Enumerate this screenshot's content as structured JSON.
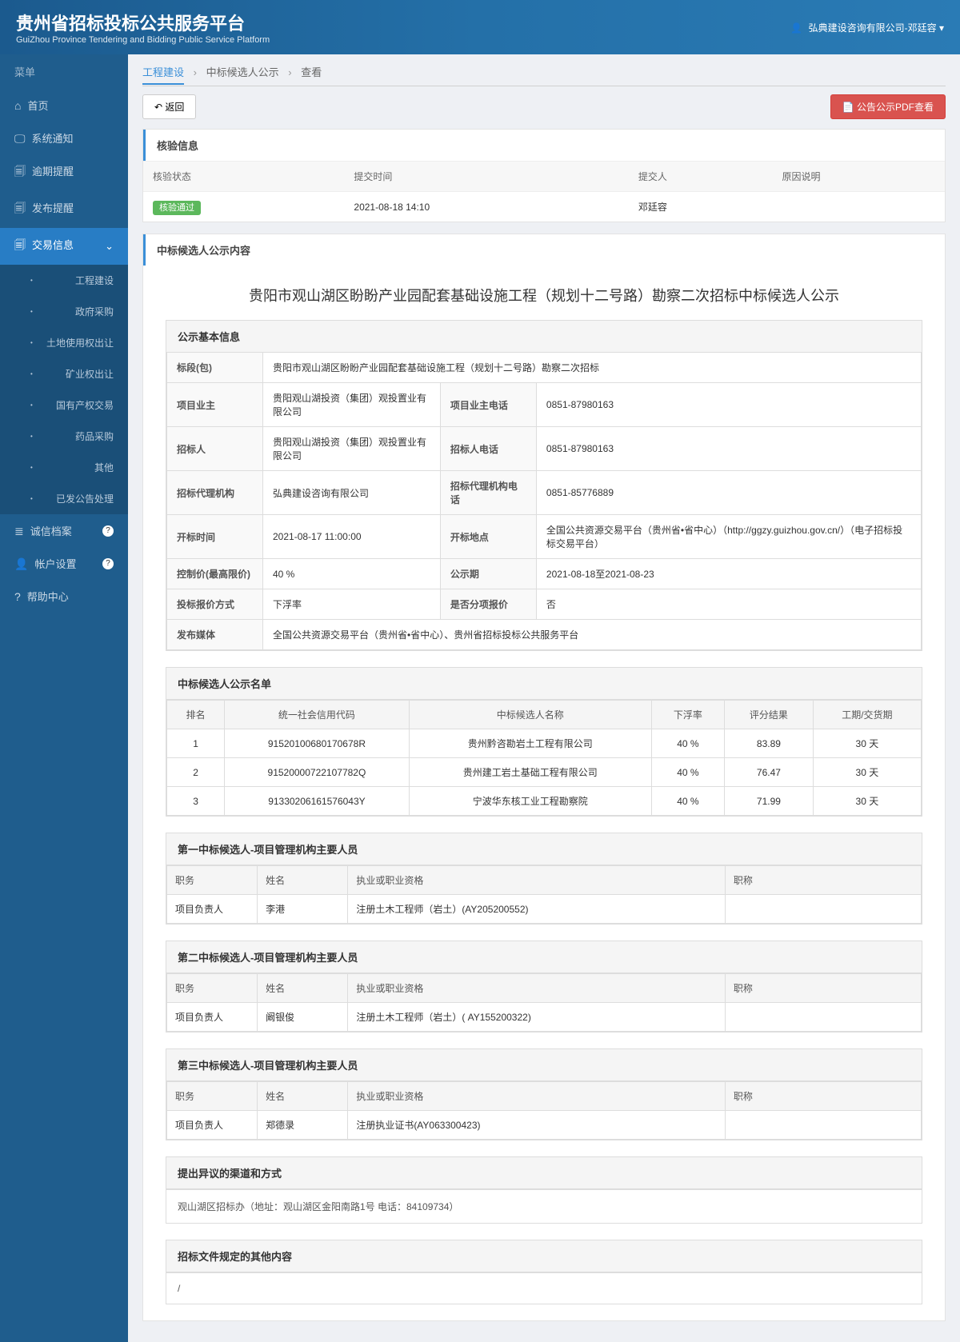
{
  "header": {
    "title": "贵州省招标投标公共服务平台",
    "subtitle": "GuiZhou Province Tendering and Bidding Public Service Platform",
    "user": "弘典建设咨询有限公司-邓廷容"
  },
  "sidebar": {
    "menu_label": "菜单",
    "items": [
      {
        "label": "首页",
        "icon": "⌂"
      },
      {
        "label": "系统通知",
        "icon": "🖵"
      },
      {
        "label": "逾期提醒",
        "icon": "🗐"
      },
      {
        "label": "发布提醒",
        "icon": "🗐"
      },
      {
        "label": "交易信息",
        "icon": "🗐",
        "active": true,
        "expand": "⌄"
      },
      {
        "label": "诚信档案",
        "icon": "≣",
        "badge": "?"
      },
      {
        "label": "帐户设置",
        "icon": "👤",
        "badge": "?"
      },
      {
        "label": "帮助中心",
        "icon": "?"
      }
    ],
    "sub_items": [
      {
        "label": "工程建设"
      },
      {
        "label": "政府采购"
      },
      {
        "label": "土地使用权出让"
      },
      {
        "label": "矿业权出让"
      },
      {
        "label": "国有产权交易"
      },
      {
        "label": "药品采购"
      },
      {
        "label": "其他"
      },
      {
        "label": "已发公告处理"
      }
    ]
  },
  "breadcrumb": [
    "工程建设",
    "中标候选人公示",
    "查看"
  ],
  "toolbar": {
    "back": "↶ 返回",
    "pdf": "📄 公告公示PDF查看"
  },
  "verify": {
    "title": "核验信息",
    "headers": [
      "核验状态",
      "提交时间",
      "提交人",
      "原因说明"
    ],
    "row": {
      "status": "核验通过",
      "time": "2021-08-18 14:10",
      "submitter": "邓廷容",
      "reason": ""
    }
  },
  "content_header": "中标候选人公示内容",
  "content_title": "贵阳市观山湖区盼盼产业园配套基础设施工程（规划十二号路）勘察二次招标中标候选人公示",
  "basic": {
    "title": "公示基本信息",
    "rows": [
      [
        {
          "k": "标段(包)",
          "v": "贵阳市观山湖区盼盼产业园配套基础设施工程（规划十二号路）勘察二次招标",
          "span": 3
        }
      ],
      [
        {
          "k": "项目业主",
          "v": "贵阳观山湖投资（集团）观投置业有限公司"
        },
        {
          "k": "项目业主电话",
          "v": "0851-87980163"
        }
      ],
      [
        {
          "k": "招标人",
          "v": "贵阳观山湖投资（集团）观投置业有限公司"
        },
        {
          "k": "招标人电话",
          "v": "0851-87980163"
        }
      ],
      [
        {
          "k": "招标代理机构",
          "v": "弘典建设咨询有限公司"
        },
        {
          "k": "招标代理机构电话",
          "v": "0851-85776889"
        }
      ],
      [
        {
          "k": "开标时间",
          "v": "2021-08-17 11:00:00"
        },
        {
          "k": "开标地点",
          "v": "全国公共资源交易平台（贵州省•省中心）（http://ggzy.guizhou.gov.cn/）（电子招标投标交易平台）"
        }
      ],
      [
        {
          "k": "控制价(最高限价)",
          "v": "40 %"
        },
        {
          "k": "公示期",
          "v": "2021-08-18至2021-08-23"
        }
      ],
      [
        {
          "k": "投标报价方式",
          "v": "下浮率"
        },
        {
          "k": "是否分项报价",
          "v": "否"
        }
      ],
      [
        {
          "k": "发布媒体",
          "v": "全国公共资源交易平台（贵州省•省中心）、贵州省招标投标公共服务平台",
          "span": 3
        }
      ]
    ]
  },
  "candidates": {
    "title": "中标候选人公示名单",
    "headers": [
      "排名",
      "统一社会信用代码",
      "中标候选人名称",
      "下浮率",
      "评分结果",
      "工期/交货期"
    ],
    "rows": [
      [
        "1",
        "91520100680170678R",
        "贵州黔咨勘岩土工程有限公司",
        "40 %",
        "83.89",
        "30 天"
      ],
      [
        "2",
        "91520000722107782Q",
        "贵州建工岩土基础工程有限公司",
        "40 %",
        "76.47",
        "30 天"
      ],
      [
        "3",
        "91330206161576043Y",
        "宁波华东核工业工程勘察院",
        "40 %",
        "71.99",
        "30 天"
      ]
    ]
  },
  "personnel": [
    {
      "title": "第一中标候选人-项目管理机构主要人员",
      "headers": [
        "职务",
        "姓名",
        "执业或职业资格",
        "职称"
      ],
      "rows": [
        [
          "项目负责人",
          "李港",
          "注册土木工程师（岩土）(AY205200552)",
          ""
        ]
      ]
    },
    {
      "title": "第二中标候选人-项目管理机构主要人员",
      "headers": [
        "职务",
        "姓名",
        "执业或职业资格",
        "职称"
      ],
      "rows": [
        [
          "项目负责人",
          "阚银俊",
          "注册土木工程师（岩土）( AY155200322)",
          ""
        ]
      ]
    },
    {
      "title": "第三中标候选人-项目管理机构主要人员",
      "headers": [
        "职务",
        "姓名",
        "执业或职业资格",
        "职称"
      ],
      "rows": [
        [
          "项目负责人",
          "郑德录",
          "注册执业证书(AY063300423)",
          ""
        ]
      ]
    }
  ],
  "objection": {
    "title": "提出异议的渠道和方式",
    "content": "观山湖区招标办（地址：观山湖区金阳南路1号 电话：84109734）"
  },
  "other": {
    "title": "招标文件规定的其他内容",
    "content": "/"
  }
}
